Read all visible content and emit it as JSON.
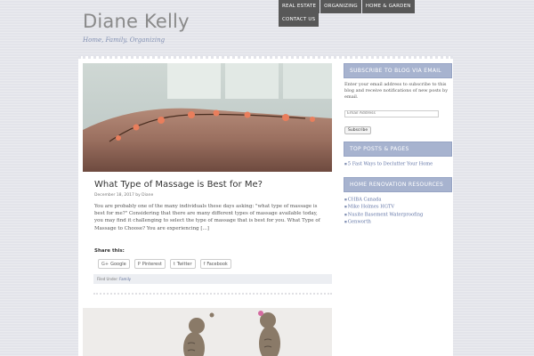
{
  "site": {
    "title": "Diane Kelly",
    "description": "Home, Family, Organizing"
  },
  "nav": {
    "items": [
      "REAL ESTATE",
      "ORGANIZING",
      "HOME & GARDEN",
      "CONTACT US"
    ]
  },
  "post": {
    "title": "What Type of Massage is Best for Me?",
    "meta": "December 18, 2017 by Diane",
    "excerpt": " You are probably one of the many individuals these days asking: \"what type of massage is best for me?\" Considering that there are many different types of massage available today, you may find it challenging to select the type of massage that is best for you. What Type of Massage to Choose? You are experiencing [...]",
    "share_title": "Share this:",
    "share_buttons": [
      {
        "icon": "G+",
        "label": "Google"
      },
      {
        "icon": "P",
        "label": "Pinterest"
      },
      {
        "icon": "t",
        "label": "Twitter"
      },
      {
        "icon": "f",
        "label": "Facebook"
      }
    ],
    "filed_label": "Filed Under:",
    "filed_category": "Family"
  },
  "sidebar": {
    "subscribe": {
      "title": "SUBSCRIBE TO BLOG VIA EMAIL",
      "text": "Enter your email address to subscribe to this blog and receive notifications of new posts by email.",
      "placeholder": "Email Address",
      "button": "Subscribe"
    },
    "top_posts": {
      "title": "TOP POSTS & PAGES",
      "items": [
        "5 Fast Ways to Declutter Your Home"
      ]
    },
    "renovation": {
      "title": "HOME RENOVATION RESOURCES",
      "items": [
        "CHBA Canada",
        "Mike Holmes HGTV",
        "Nusite Basement Waterproofing",
        "Genworth"
      ]
    }
  }
}
